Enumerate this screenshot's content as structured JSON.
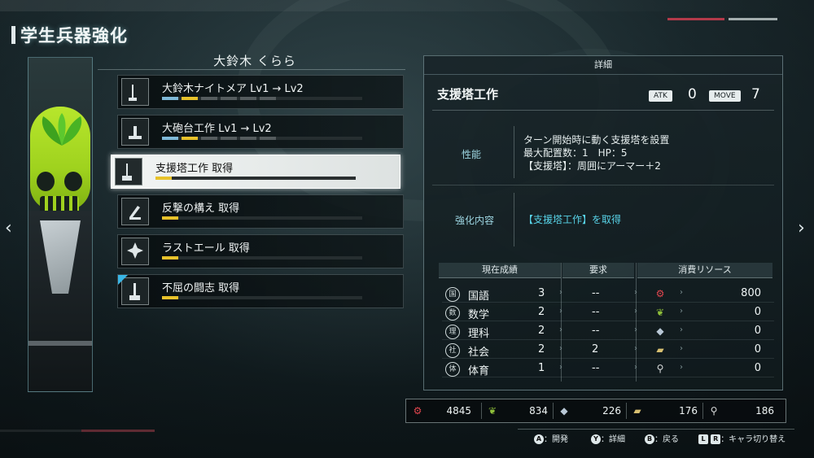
{
  "header": {
    "title": "学生兵器強化"
  },
  "character": {
    "name": "大鈴木 くらら"
  },
  "upgrades": [
    {
      "label": "大鈴木ナイトメア Lv1 → Lv2",
      "icon": "weapon-icon",
      "selected": false,
      "new": false,
      "segments": [
        "#7fb9d8",
        "#e8c22b",
        "#555c5e",
        "#555c5e",
        "#555c5e",
        "#555c5e"
      ]
    },
    {
      "label": "大砲台工作 Lv1 → Lv2",
      "icon": "turret-icon",
      "selected": false,
      "new": false,
      "segments": [
        "#7fb9d8",
        "#e8c22b",
        "#555c5e",
        "#555c5e",
        "#555c5e",
        "#555c5e"
      ]
    },
    {
      "label": "支援塔工作 取得",
      "icon": "support-tower-icon",
      "selected": true,
      "new": false,
      "segments": [
        "#e8c22b"
      ]
    },
    {
      "label": "反撃の構え 取得",
      "icon": "counter-stance-icon",
      "selected": false,
      "new": false,
      "segments": [
        "#e8c22b"
      ]
    },
    {
      "label": "ラストエール 取得",
      "icon": "last-ale-icon",
      "selected": false,
      "new": false,
      "segments": [
        "#e8c22b"
      ]
    },
    {
      "label": "不屈の闘志 取得",
      "icon": "indomitable-icon",
      "selected": false,
      "new": true,
      "segments": [
        "#e8c22b"
      ]
    }
  ],
  "detail": {
    "header": "詳細",
    "title": "支援塔工作",
    "atk_label": "ATK",
    "atk_value": "0",
    "move_label": "MOVE",
    "move_value": "7",
    "performance_label": "性能",
    "performance_lines": [
      "ターン開始時に動く支援塔を設置",
      "最大配置数：1　HP：5",
      "【支援塔】：周囲にアーマー＋2"
    ],
    "enhance_label": "強化内容",
    "enhance_text": "【支援塔工作】を取得",
    "table": {
      "col_current": "現在成績",
      "col_required": "要求",
      "col_resources": "消費リソース",
      "rows": [
        {
          "subject": "国語",
          "icon": "国",
          "current": "3",
          "required": "--",
          "resource_icon": "gear-resource-icon",
          "resource_color": "#e0464e",
          "cost": "800"
        },
        {
          "subject": "数学",
          "icon": "数",
          "current": "2",
          "required": "--",
          "resource_icon": "leaf-resource-icon",
          "resource_color": "#8fbf3a",
          "cost": "0"
        },
        {
          "subject": "理科",
          "icon": "理",
          "current": "2",
          "required": "--",
          "resource_icon": "crystal-resource-icon",
          "resource_color": "#b9c8d6",
          "cost": "0"
        },
        {
          "subject": "社会",
          "icon": "社",
          "current": "2",
          "required": "2",
          "resource_icon": "ration-resource-icon",
          "resource_color": "#d8c071",
          "cost": "0"
        },
        {
          "subject": "体育",
          "icon": "体",
          "current": "1",
          "required": "--",
          "resource_icon": "tool-resource-icon",
          "resource_color": "#d9dcdc",
          "cost": "0"
        }
      ]
    }
  },
  "resources": [
    {
      "icon": "gear-resource-icon",
      "color": "#e0464e",
      "value": "4845"
    },
    {
      "icon": "leaf-resource-icon",
      "color": "#8fbf3a",
      "value": "834"
    },
    {
      "icon": "crystal-resource-icon",
      "color": "#b9c8d6",
      "value": "226"
    },
    {
      "icon": "ration-resource-icon",
      "color": "#d8c071",
      "value": "176"
    },
    {
      "icon": "tool-resource-icon",
      "color": "#d9dcdc",
      "value": "186"
    }
  ],
  "guide": [
    {
      "button": "A",
      "label": "：開発"
    },
    {
      "button": "Y",
      "label": "：詳細"
    },
    {
      "button": "B",
      "label": "：戻る"
    },
    {
      "button": "L",
      "button2": "R",
      "label": "：キャラ切り替え"
    }
  ]
}
